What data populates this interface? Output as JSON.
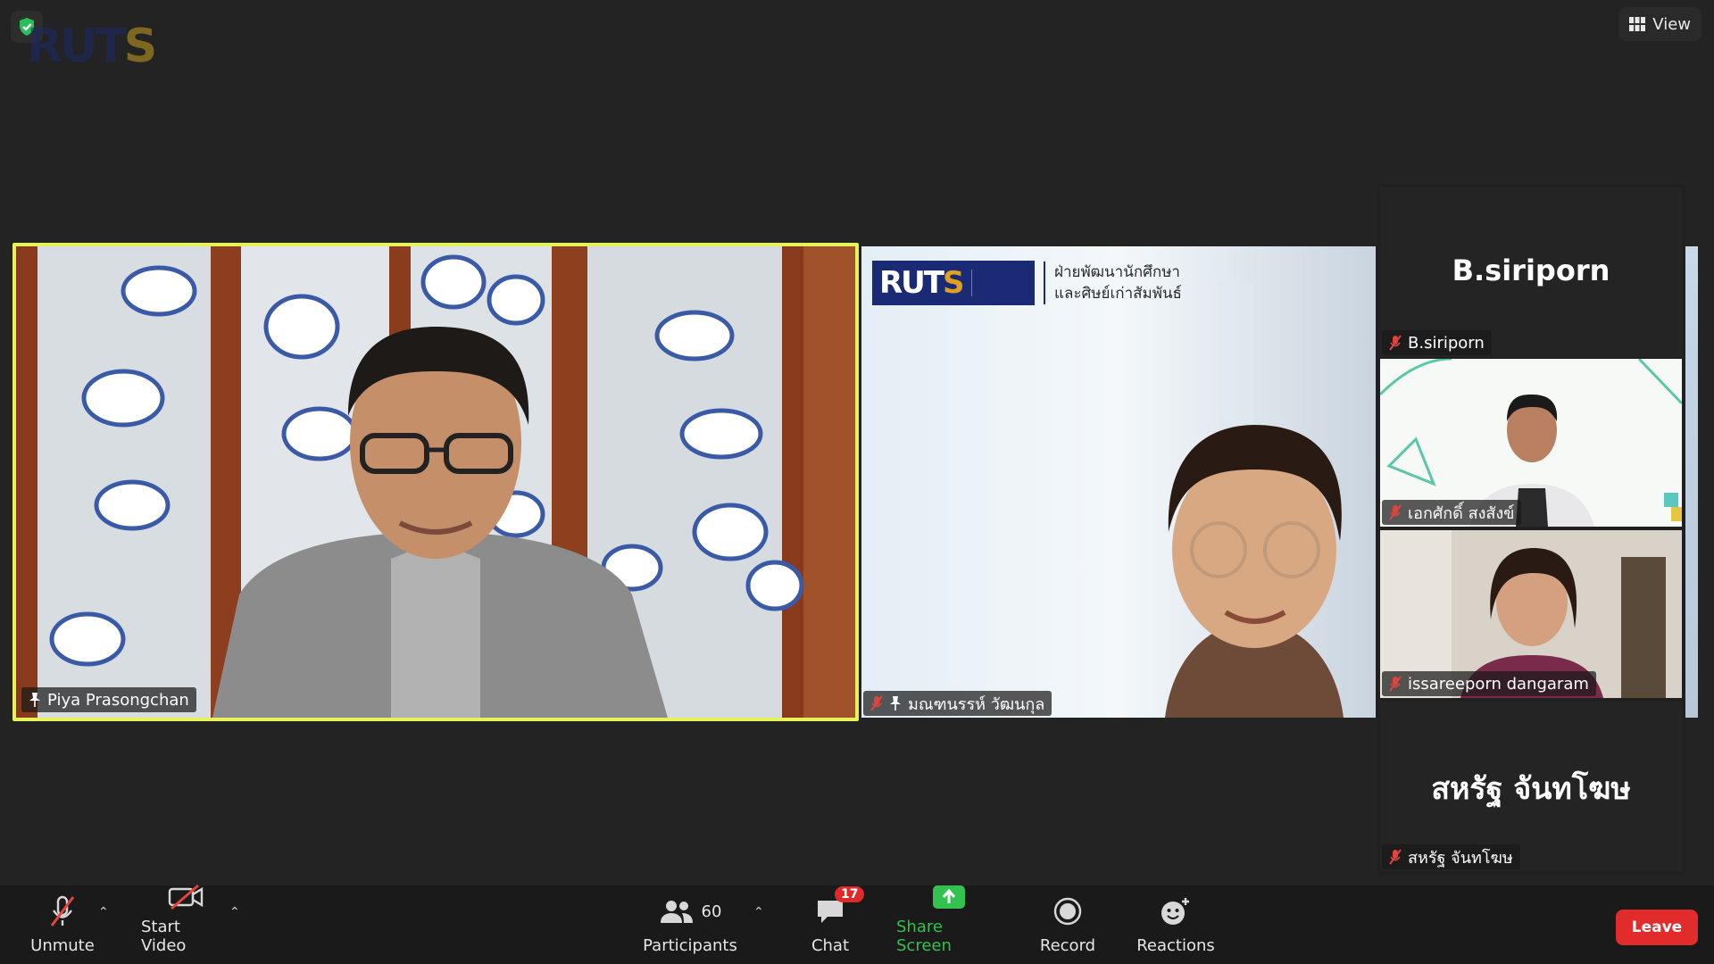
{
  "topbar": {
    "view_label": "View"
  },
  "main_tile": {
    "name": "Piya Prasongchan"
  },
  "second_tile": {
    "name": "มณฑนรรห์ วัฒนกุล",
    "banner_line1": "ฝ่ายพัฒนานักศึกษา",
    "banner_line2": "และศิษย์เก่าสัมพันธ์"
  },
  "sidebar": {
    "tiles": [
      {
        "display": "B.siriporn",
        "name": "B.siriporn"
      },
      {
        "name": "เอกศักดิ์ สงสังข์"
      },
      {
        "name": "issareeporn dangaram"
      },
      {
        "display": "สหรัฐ จันทโฆษ",
        "name": "สหรัฐ จันทโฆษ"
      }
    ]
  },
  "toolbar": {
    "unmute": "Unmute",
    "start_video": "Start Video",
    "participants_label": "Participants",
    "participants_count": "60",
    "chat_label": "Chat",
    "chat_badge": "17",
    "share_label": "Share Screen",
    "record_label": "Record",
    "reactions_label": "Reactions",
    "leave_label": "Leave"
  },
  "colors": {
    "active_speaker_border": "#e6f25a",
    "share_green": "#32c24d",
    "leave_red": "#e22c2c",
    "muted_red": "#e0443c"
  }
}
